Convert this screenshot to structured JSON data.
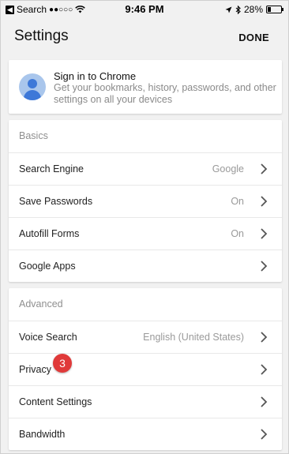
{
  "status_bar": {
    "carrier": "Search",
    "signal": "●●○○○",
    "time": "9:46 PM",
    "battery": "28%",
    "battery_level": 0.28
  },
  "header": {
    "title": "Settings",
    "done_label": "DONE"
  },
  "signin": {
    "title": "Sign in to Chrome",
    "subtitle": "Get your bookmarks, history, passwords, and other settings on all your devices"
  },
  "basics": {
    "label": "Basics",
    "rows": [
      {
        "label": "Search Engine",
        "value": "Google"
      },
      {
        "label": "Save Passwords",
        "value": "On"
      },
      {
        "label": "Autofill Forms",
        "value": "On"
      },
      {
        "label": "Google Apps",
        "value": ""
      }
    ]
  },
  "advanced": {
    "label": "Advanced",
    "rows": [
      {
        "label": "Voice Search",
        "value": "English (United States)"
      },
      {
        "label": "Privacy",
        "value": ""
      },
      {
        "label": "Content Settings",
        "value": ""
      },
      {
        "label": "Bandwidth",
        "value": ""
      }
    ]
  },
  "annotation": {
    "step_number": "3",
    "color": "#e03a3a"
  }
}
